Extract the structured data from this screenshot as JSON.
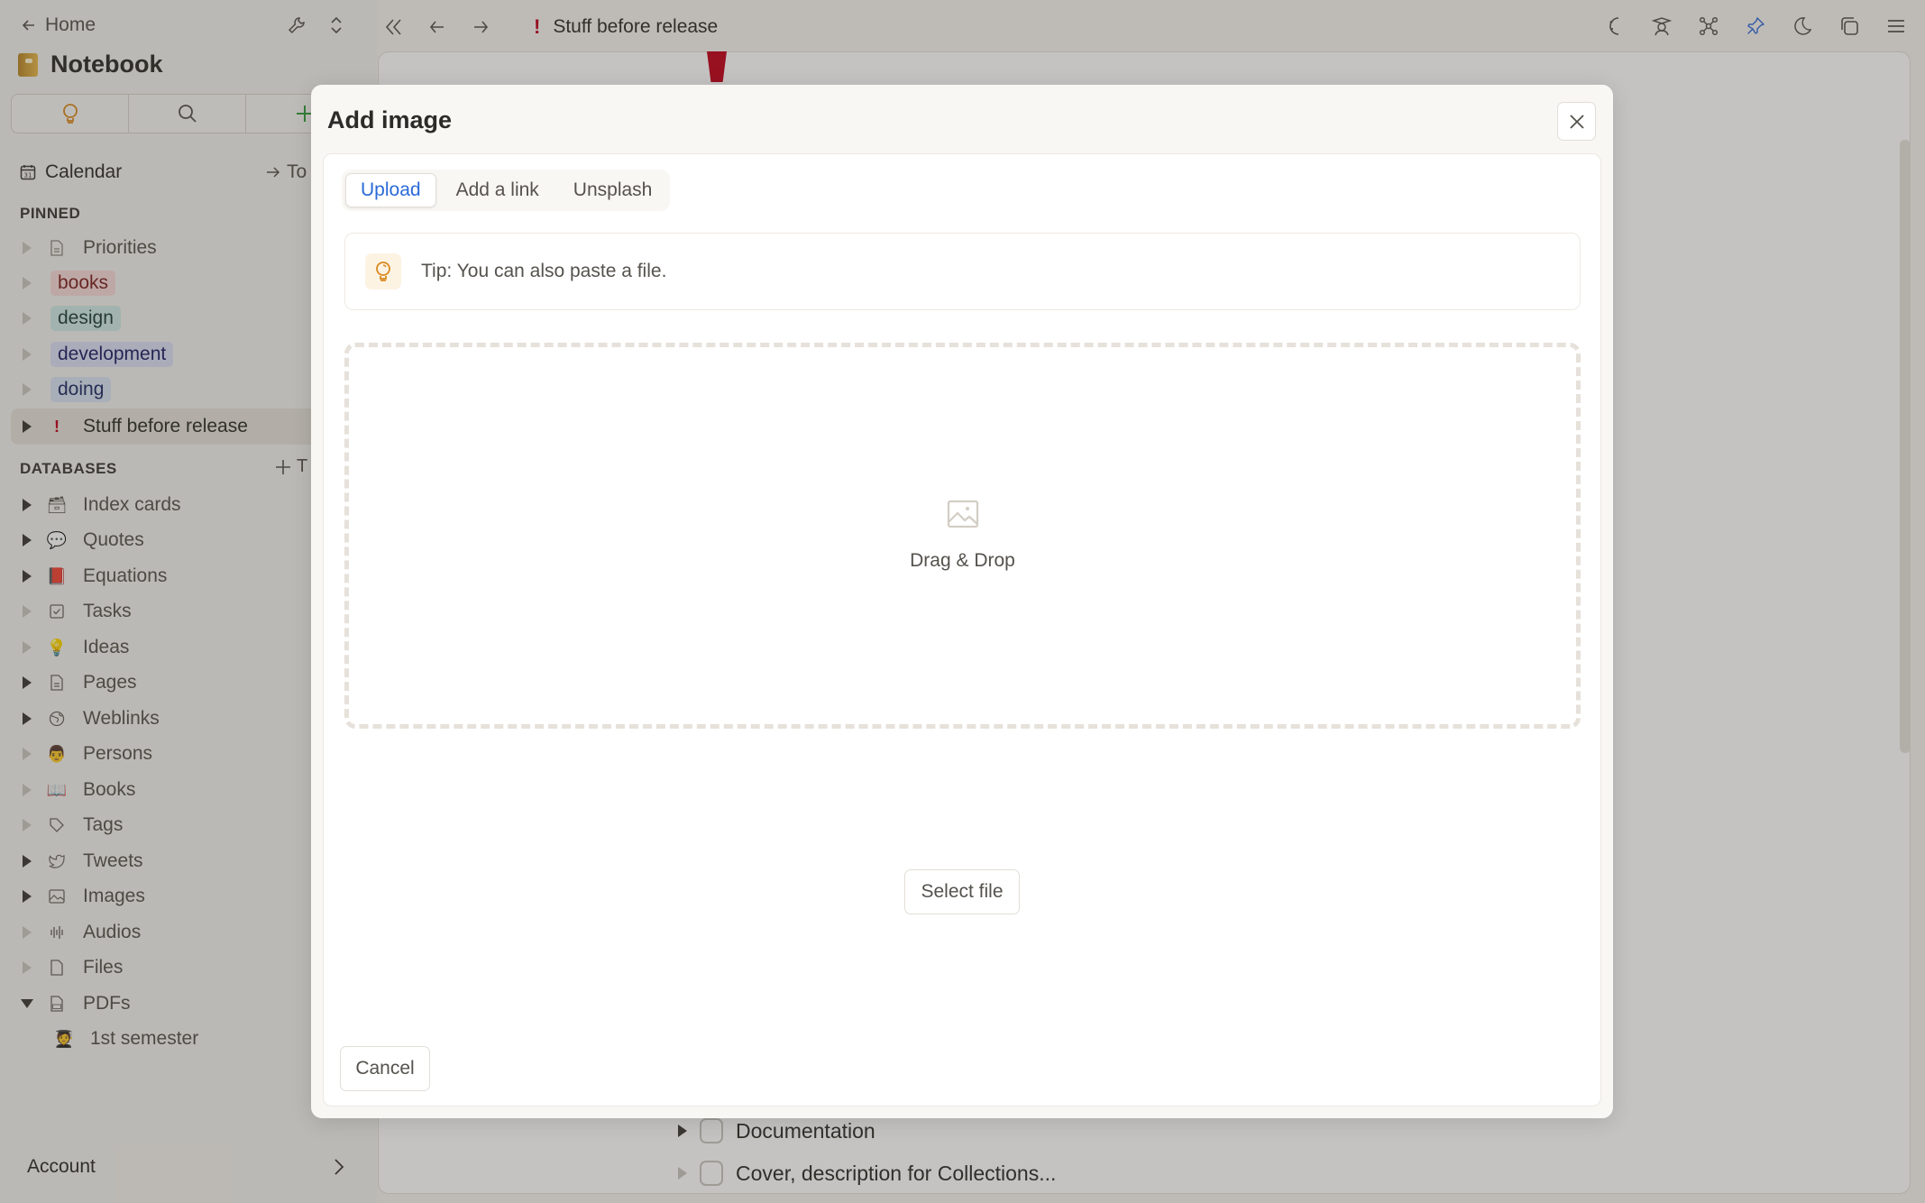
{
  "sidebar": {
    "home_label": "Home",
    "title": "Notebook",
    "toolbar": [
      {
        "icon": "lightbulb-icon"
      },
      {
        "icon": "search-icon"
      },
      {
        "icon": "plus-icon"
      }
    ],
    "calendar_label": "Calendar",
    "today_label": "To",
    "pinned_header": "PINNED",
    "pinned": [
      {
        "label": "Priorities",
        "icon": "page-icon",
        "expandable": false
      },
      {
        "label": "books",
        "tag": "books",
        "expandable": false
      },
      {
        "label": "design",
        "tag": "design",
        "expandable": false
      },
      {
        "label": "development",
        "tag": "development",
        "expandable": false
      },
      {
        "label": "doing",
        "tag": "doing",
        "expandable": false
      },
      {
        "label": "Stuff before release",
        "icon": "exclamation-icon",
        "expandable": true,
        "active": true
      }
    ],
    "databases_header": "DATABASES",
    "databases_add": "T",
    "databases": [
      {
        "label": "Index cards",
        "icon": "card-file-box-icon",
        "expandable": true
      },
      {
        "label": "Quotes",
        "icon": "speech-bubble-icon",
        "expandable": true
      },
      {
        "label": "Equations",
        "icon": "red-book-icon",
        "expandable": true
      },
      {
        "label": "Tasks",
        "icon": "checkbox-icon",
        "expandable": false
      },
      {
        "label": "Ideas",
        "icon": "lightbulb-icon",
        "expandable": false
      },
      {
        "label": "Pages",
        "icon": "page-icon",
        "expandable": true
      },
      {
        "label": "Weblinks",
        "icon": "globe-icon",
        "expandable": true
      },
      {
        "label": "Persons",
        "icon": "person-icon",
        "expandable": false
      },
      {
        "label": "Books",
        "icon": "open-book-icon",
        "expandable": false
      },
      {
        "label": "Tags",
        "icon": "tag-icon",
        "expandable": false
      },
      {
        "label": "Tweets",
        "icon": "bird-icon",
        "expandable": true
      },
      {
        "label": "Images",
        "icon": "image-icon",
        "expandable": true
      },
      {
        "label": "Audios",
        "icon": "waveform-icon",
        "expandable": false
      },
      {
        "label": "Files",
        "icon": "file-icon",
        "expandable": false
      },
      {
        "label": "PDFs",
        "icon": "pdf-icon",
        "expandable": true,
        "expanded": true
      }
    ],
    "pdf_children": [
      {
        "label": "1st semester",
        "icon": "student-icon"
      }
    ],
    "account_label": "Account"
  },
  "topbar": {
    "page_title": "Stuff before release",
    "page_icon": "!",
    "right_icons": [
      "magic-moon-icon",
      "student-hat-icon",
      "graph-icon",
      "pin-icon",
      "moon-icon",
      "copy-icon",
      "menu-icon"
    ],
    "pin_color": "#3a6fd8"
  },
  "background_page": {
    "tasks": [
      {
        "label": "Documentation"
      },
      {
        "label": "Cover, description for Collections..."
      }
    ]
  },
  "modal": {
    "title": "Add image",
    "tabs": [
      {
        "label": "Upload",
        "active": true
      },
      {
        "label": "Add a link",
        "active": false
      },
      {
        "label": "Unsplash",
        "active": false
      }
    ],
    "tip": "Tip: You can also paste a file.",
    "dropzone_label": "Drag & Drop",
    "select_file_label": "Select file",
    "cancel_label": "Cancel"
  },
  "colors": {
    "accent_blue": "#2a6ad8",
    "tip_orange": "#d98a1f",
    "plus_green": "#2e9e3c",
    "danger_red": "#c0001a"
  }
}
